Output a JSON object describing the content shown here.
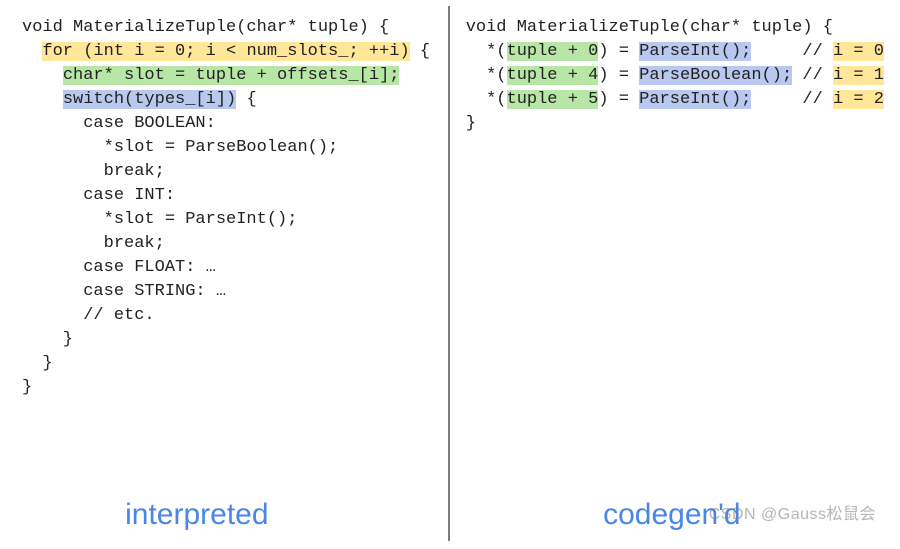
{
  "left": {
    "lines": [
      [
        {
          "t": "void MaterializeTuple(char* tuple) {",
          "hl": ""
        }
      ],
      [
        {
          "t": "  ",
          "hl": ""
        },
        {
          "t": "for (int i = 0; i < num_slots_; ++i)",
          "hl": "yellow"
        },
        {
          "t": " {",
          "hl": ""
        }
      ],
      [
        {
          "t": "    ",
          "hl": ""
        },
        {
          "t": "char* slot = tuple + offsets_[i];",
          "hl": "green"
        }
      ],
      [
        {
          "t": "    ",
          "hl": ""
        },
        {
          "t": "switch(types_[i])",
          "hl": "blue"
        },
        {
          "t": " {",
          "hl": ""
        }
      ],
      [
        {
          "t": "      case BOOLEAN:",
          "hl": ""
        }
      ],
      [
        {
          "t": "        *slot = ParseBoolean();",
          "hl": ""
        }
      ],
      [
        {
          "t": "        break;",
          "hl": ""
        }
      ],
      [
        {
          "t": "      case INT:",
          "hl": ""
        }
      ],
      [
        {
          "t": "        *slot = ParseInt();",
          "hl": ""
        }
      ],
      [
        {
          "t": "        break;",
          "hl": ""
        }
      ],
      [
        {
          "t": "      case FLOAT: …",
          "hl": ""
        }
      ],
      [
        {
          "t": "      case STRING: …",
          "hl": ""
        }
      ],
      [
        {
          "t": "      // etc.",
          "hl": ""
        }
      ],
      [
        {
          "t": "    }",
          "hl": ""
        }
      ],
      [
        {
          "t": "  }",
          "hl": ""
        }
      ],
      [
        {
          "t": "}",
          "hl": ""
        }
      ]
    ],
    "caption": "interpreted"
  },
  "right": {
    "lines": [
      [
        {
          "t": "void MaterializeTuple(char* tuple) {",
          "hl": ""
        }
      ],
      [
        {
          "t": "  *(",
          "hl": ""
        },
        {
          "t": "tuple + 0",
          "hl": "green"
        },
        {
          "t": ") = ",
          "hl": ""
        },
        {
          "t": "ParseInt();",
          "hl": "blue"
        },
        {
          "t": "     // ",
          "hl": ""
        },
        {
          "t": "i = 0",
          "hl": "yellow"
        }
      ],
      [
        {
          "t": "  *(",
          "hl": ""
        },
        {
          "t": "tuple + 4",
          "hl": "green"
        },
        {
          "t": ") = ",
          "hl": ""
        },
        {
          "t": "ParseBoolean();",
          "hl": "blue"
        },
        {
          "t": " // ",
          "hl": ""
        },
        {
          "t": "i = 1",
          "hl": "yellow"
        }
      ],
      [
        {
          "t": "  *(",
          "hl": ""
        },
        {
          "t": "tuple + 5",
          "hl": "green"
        },
        {
          "t": ") = ",
          "hl": ""
        },
        {
          "t": "ParseInt();",
          "hl": "blue"
        },
        {
          "t": "     // ",
          "hl": ""
        },
        {
          "t": "i = 2",
          "hl": "yellow"
        }
      ],
      [
        {
          "t": "}",
          "hl": ""
        }
      ]
    ],
    "caption": "codegen'd"
  },
  "watermark": "CSDN @Gauss松鼠会"
}
